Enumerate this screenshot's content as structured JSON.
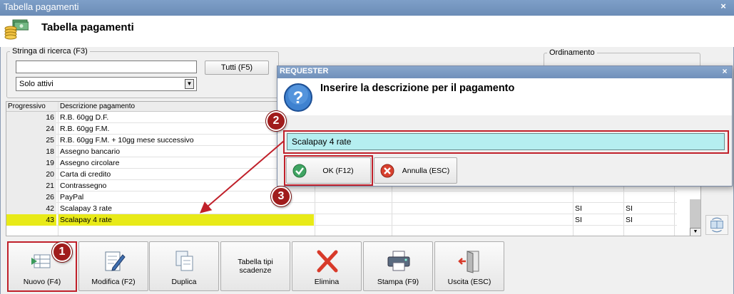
{
  "window": {
    "title": "Tabella pagamenti",
    "close_glyph": "×",
    "header_title": "Tabella pagamenti",
    "header_icon": "coins-money-icon"
  },
  "search": {
    "legend": "Stringa di ricerca (F3)",
    "value": "",
    "all_button": "Tutti (F5)",
    "filter_value": "Solo attivi"
  },
  "order": {
    "legend": "Ordinamento"
  },
  "grid": {
    "columns": [
      "Progressivo",
      "Descrizione pagamento"
    ],
    "rows": [
      {
        "num": "16",
        "desc": "R.B. 60gg D.F.",
        "a": "",
        "b": ""
      },
      {
        "num": "24",
        "desc": "R.B. 60gg F.M.",
        "a": "",
        "b": ""
      },
      {
        "num": "25",
        "desc": "R.B. 60gg F.M. + 10gg mese successivo",
        "a": "",
        "b": ""
      },
      {
        "num": "18",
        "desc": "Assegno bancario",
        "a": "",
        "b": ""
      },
      {
        "num": "19",
        "desc": "Assegno circolare",
        "a": "",
        "b": ""
      },
      {
        "num": "20",
        "desc": "Carta di credito",
        "a": "",
        "b": ""
      },
      {
        "num": "21",
        "desc": "Contrassegno",
        "a": "",
        "b": ""
      },
      {
        "num": "26",
        "desc": "PayPal",
        "a": "",
        "b": ""
      },
      {
        "num": "42",
        "desc": "Scalapay 3 rate",
        "a": "SI",
        "b": "SI"
      },
      {
        "num": "43",
        "desc": "Scalapay 4 rate",
        "a": "SI",
        "b": "SI"
      }
    ],
    "selected_row": 9,
    "selection_color": "#e8ea18"
  },
  "toolbar": {
    "new": "Nuovo (F4)",
    "edit": "Modifica (F2)",
    "duplicate": "Duplica",
    "tipi_line1": "Tabella tipi",
    "tipi_line2": "scadenze",
    "delete": "Elimina",
    "print": "Stampa (F9)",
    "exit": "Uscita (ESC)"
  },
  "dialog": {
    "title": "REQUESTER",
    "close_glyph": "×",
    "prompt": "Inserire la descrizione per il pagamento",
    "input_value": "Scalapay 4 rate",
    "ok": "OK (F12)",
    "cancel": "Annulla (ESC)",
    "input_color": "#b5eef0"
  },
  "annotations": {
    "badge1": "1",
    "badge2": "2",
    "badge3": "3",
    "color": "#c0202a"
  }
}
